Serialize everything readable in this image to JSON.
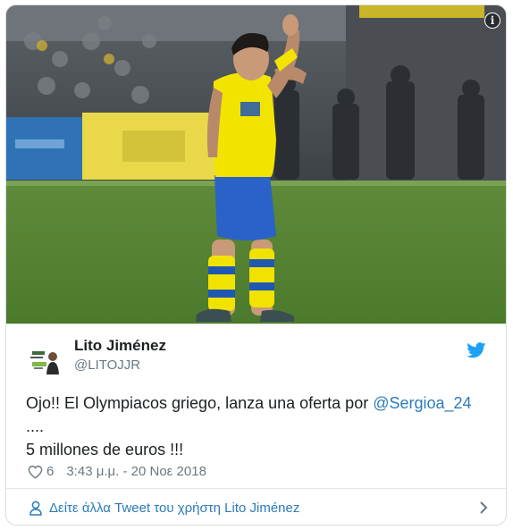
{
  "author": {
    "name": "Lito Jiménez",
    "handle": "@LITOJJR"
  },
  "tweet": {
    "text_before_mention": "Ojo!! El Olympiacos griego, lanza una oferta por ",
    "mention": "@Sergioa_24",
    "line2": "....",
    "line3": "5 millones de euros !!!"
  },
  "meta": {
    "likes": "6",
    "timestamp": "3:43 μ.μ. - 20 Νοε 2018"
  },
  "footer": {
    "label": "Δείτε άλλα Tweet του χρήστη Lito Jiménez"
  },
  "colors": {
    "link": "#2b7bb9",
    "twitter_blue": "#1da1f2",
    "secondary_text": "#697882"
  },
  "icons": {
    "info": "info-icon",
    "bird": "twitter-bird-icon",
    "heart": "heart-icon",
    "user": "user-icon",
    "chevron": "chevron-right-icon"
  }
}
